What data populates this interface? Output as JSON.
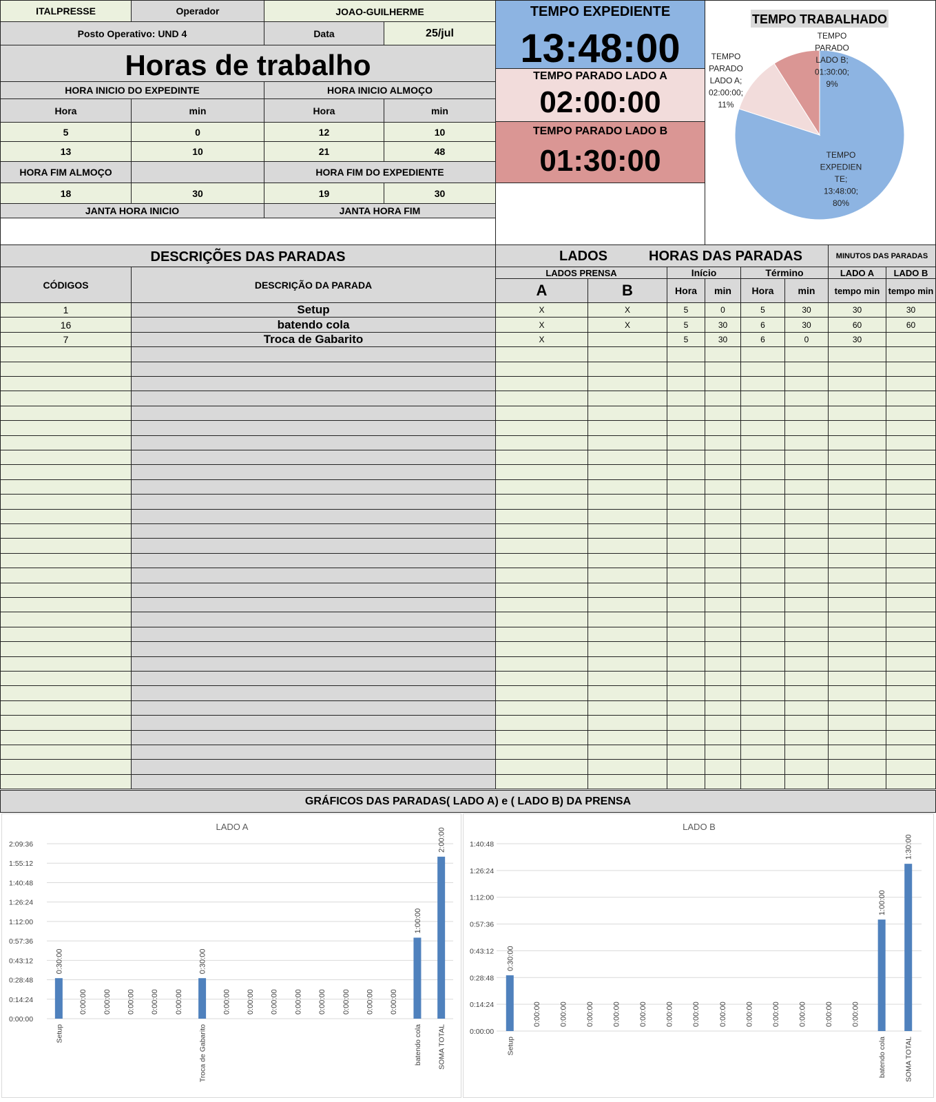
{
  "header": {
    "company": "ITALPRESSE",
    "operator_label": "Operador",
    "operator_name": "JOAO-GUILHERME",
    "posto": "Posto Operativo: UND 4",
    "data_label": "Data",
    "data_value": "25/jul",
    "title": "Horas de trabalho",
    "inicio_expediente_label": "HORA INICIO DO EXPEDINTE",
    "inicio_almoco_label": "HORA INICIO ALMOÇO",
    "hora_label": "Hora",
    "min_label": "min",
    "row1": [
      "5",
      "0",
      "12",
      "10"
    ],
    "row2": [
      "13",
      "10",
      "21",
      "48"
    ],
    "fim_almoco_label": "HORA FIM ALMOÇO",
    "fim_expediente_label": "HORA FIM DO EXPEDIENTE",
    "row3": [
      "18",
      "30",
      "19",
      "30"
    ],
    "janta_inicio_label": "JANTA HORA INICIO",
    "janta_fim_label": "JANTA HORA FIM"
  },
  "timers": {
    "expediente_label": "TEMPO EXPEDIENTE",
    "expediente_value": "13:48:00",
    "parado_a_label": "TEMPO PARADO LADO A",
    "parado_a_value": "02:00:00",
    "parado_b_label": "TEMPO PARADO LADO B",
    "parado_b_value": "01:30:00",
    "colors": {
      "expediente": "#8db4e2",
      "parado_a": "#f2dcdb",
      "parado_b": "#da9694"
    }
  },
  "table": {
    "title_desc": "DESCRIÇÕES DAS PARADAS",
    "title_lados": "LADOS",
    "title_horas": "HORAS DAS PARADAS",
    "title_minutos": "MINUTOS DAS PARADAS",
    "col_codigos": "CÓDIGOS",
    "col_descricao": "DESCRIÇÃO DA PARADA",
    "lados_prensa": "LADOS PRENSA",
    "inicio": "Início",
    "termino": "Término",
    "lado_a": "LADO A",
    "lado_b": "LADO B",
    "a": "A",
    "b": "B",
    "hora": "Hora",
    "min": "min",
    "tempo_min": "tempo min",
    "rows": [
      {
        "codigo": "1",
        "descricao": "Setup",
        "a": "X",
        "b": "X",
        "ini_h": "5",
        "ini_m": "0",
        "ter_h": "5",
        "ter_m": "30",
        "min_a": "30",
        "min_b": "30"
      },
      {
        "codigo": "16",
        "descricao": "batendo cola",
        "a": "X",
        "b": "X",
        "ini_h": "5",
        "ini_m": "30",
        "ter_h": "6",
        "ter_m": "30",
        "min_a": "60",
        "min_b": "60"
      },
      {
        "codigo": "7",
        "descricao": "Troca de Gabarito",
        "a": "X",
        "b": "",
        "ini_h": "5",
        "ini_m": "30",
        "ter_h": "6",
        "ter_m": "0",
        "min_a": "30",
        "min_b": ""
      }
    ]
  },
  "charts_banner": "GRÁFICOS DAS PARADAS( LADO A) e ( LADO B) DA PRENSA",
  "chart_data": [
    {
      "type": "pie",
      "title": "TEMPO TRABALHADO",
      "slices": [
        {
          "label": "TEMPO EXPEDIENTE",
          "value": "13:48:00",
          "percent": 80,
          "color": "#8db4e2"
        },
        {
          "label": "TEMPO PARADO LADO A",
          "value": "02:00:00",
          "percent": 11,
          "color": "#f2dcdb"
        },
        {
          "label": "TEMPO PARADO LADO B",
          "value": "01:30:00",
          "percent": 9,
          "color": "#da9694"
        }
      ]
    },
    {
      "type": "bar",
      "title": "LADO A",
      "categories": [
        "Setup",
        "",
        "",
        "",
        "",
        "",
        "Troca de Gabarito",
        "",
        "",
        "",
        "",
        "",
        "",
        "",
        "",
        "batendo cola",
        "SOMA TOTAL"
      ],
      "values": [
        "0:30:00",
        "0:00:00",
        "0:00:00",
        "0:00:00",
        "0:00:00",
        "0:00:00",
        "0:30:00",
        "0:00:00",
        "0:00:00",
        "0:00:00",
        "0:00:00",
        "0:00:00",
        "0:00:00",
        "0:00:00",
        "0:00:00",
        "1:00:00",
        "2:00:00"
      ],
      "y_ticks": [
        "0:00:00",
        "0:14:24",
        "0:28:48",
        "0:43:12",
        "0:57:36",
        "1:12:00",
        "1:26:24",
        "1:40:48",
        "1:55:12",
        "2:09:36"
      ],
      "ylim_minutes": [
        0,
        129.6
      ],
      "color": "#4f81bd"
    },
    {
      "type": "bar",
      "title": "LADO B",
      "categories": [
        "Setup",
        "",
        "",
        "",
        "",
        "",
        "",
        "",
        "",
        "",
        "",
        "",
        "",
        "",
        "batendo cola",
        "SOMA TOTAL"
      ],
      "values": [
        "0:30:00",
        "0:00:00",
        "0:00:00",
        "0:00:00",
        "0:00:00",
        "0:00:00",
        "0:00:00",
        "0:00:00",
        "0:00:00",
        "0:00:00",
        "0:00:00",
        "0:00:00",
        "0:00:00",
        "0:00:00",
        "1:00:00",
        "1:30:00"
      ],
      "y_ticks": [
        "0:00:00",
        "0:14:24",
        "0:28:48",
        "0:43:12",
        "0:57:36",
        "1:12:00",
        "1:26:24",
        "1:40:48"
      ],
      "ylim_minutes": [
        0,
        100.8
      ],
      "color": "#4f81bd"
    }
  ]
}
